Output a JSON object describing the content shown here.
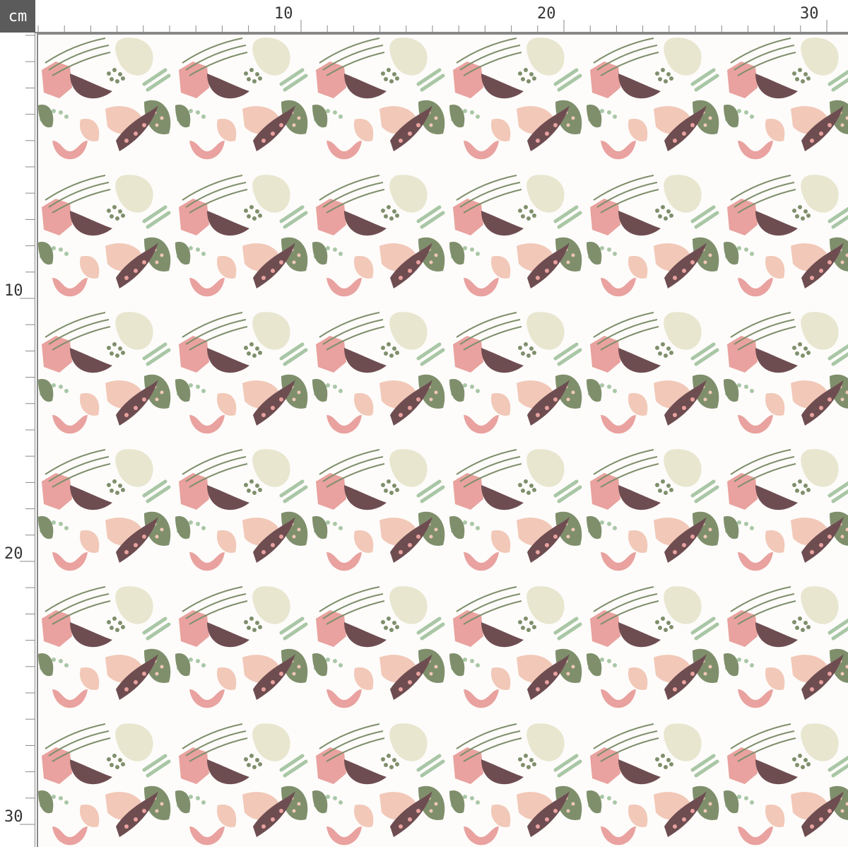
{
  "ruler": {
    "unit": "cm",
    "top_labels": [
      "10",
      "20",
      "30"
    ],
    "left_labels": [
      "10",
      "20",
      "30"
    ]
  },
  "pattern": {
    "background": "#fdfcfa",
    "colors": {
      "pink": "#e9a29f",
      "blush": "#f2c8b8",
      "plum": "#6e4d51",
      "olive": "#7f8f6c",
      "mint": "#a9c7a6",
      "cream": "#e8e6cf",
      "ruler_line": "#888888"
    }
  }
}
